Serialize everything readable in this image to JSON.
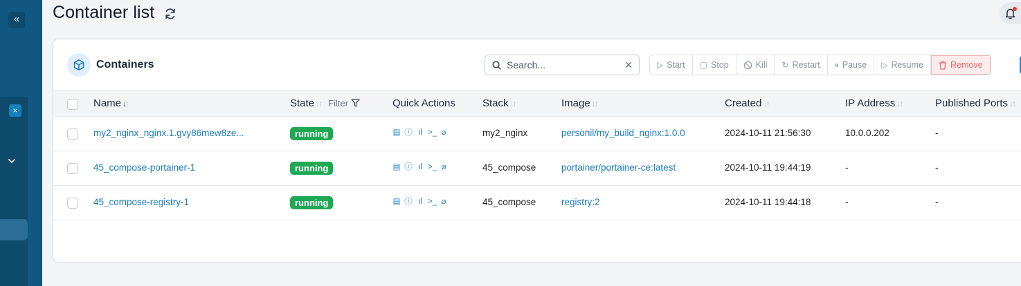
{
  "sidebar": {
    "collapse_icon": "«",
    "close_icon": "×",
    "chevron_icon": "⌄"
  },
  "header": {
    "title": "Container list",
    "refresh_icon": "refresh-icon",
    "notification_icon": "bell-icon"
  },
  "card": {
    "title": "Containers",
    "icon": "cube-icon",
    "search": {
      "placeholder": "Search...",
      "value": ""
    },
    "actions": [
      {
        "label": "Start",
        "icon": "▷"
      },
      {
        "label": "Stop",
        "icon": "▢"
      },
      {
        "label": "Kill",
        "icon": "⃠"
      },
      {
        "label": "Restart",
        "icon": "↻"
      },
      {
        "label": "Pause",
        "icon": "⏸"
      },
      {
        "label": "Resume",
        "icon": "▷"
      },
      {
        "label": "Remove",
        "icon": "🗑"
      }
    ]
  },
  "table": {
    "columns": {
      "name": "Name",
      "state": "State",
      "state_filter": "Filter",
      "quick_actions": "Quick Actions",
      "stack": "Stack",
      "image": "Image",
      "created": "Created",
      "ip": "IP Address",
      "ports": "Published Ports"
    },
    "rows": [
      {
        "name": "my2_nginx_nginx.1.gvy86mew8ze...",
        "state": "running",
        "stack": "my2_nginx",
        "image": "personil/my_build_nginx:1.0.0",
        "created": "2024-10-11 21:56:30",
        "ip": "10.0.0.202",
        "ports": "-"
      },
      {
        "name": "45_compose-portainer-1",
        "state": "running",
        "stack": "45_compose",
        "image": "portainer/portainer-ce:latest",
        "created": "2024-10-11 19:44:19",
        "ip": "-",
        "ports": "-"
      },
      {
        "name": "45_compose-registry-1",
        "state": "running",
        "stack": "45_compose",
        "image": "registry:2",
        "created": "2024-10-11 19:44:18",
        "ip": "-",
        "ports": "-"
      }
    ],
    "quick_action_icons": [
      "logs-icon",
      "inspect-icon",
      "stats-icon",
      "console-icon",
      "attach-icon"
    ]
  },
  "colors": {
    "sidebar": "#11577f",
    "accent": "#1a7cc0",
    "running": "#1ea854",
    "danger": "#e46a6a"
  }
}
